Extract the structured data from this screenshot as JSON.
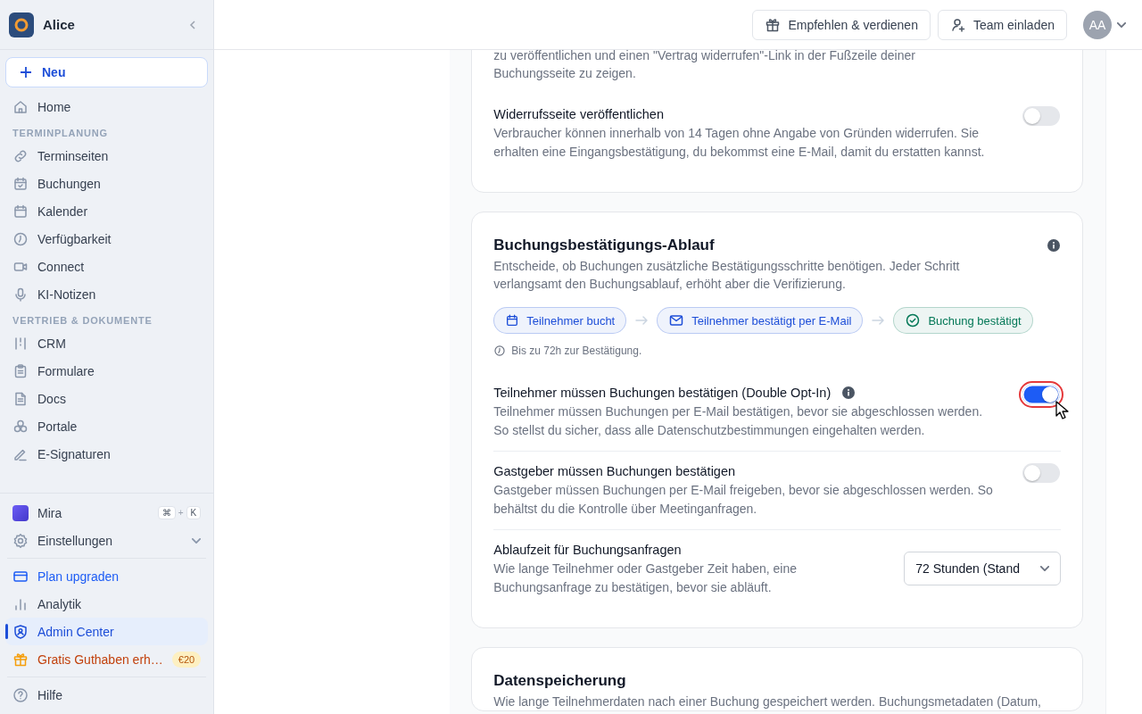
{
  "sidebar": {
    "workspace": "Alice",
    "new_button": "Neu",
    "sections": [
      {
        "items": [
          {
            "label": "Home",
            "selected": false
          }
        ]
      },
      {
        "heading": "TERMINPLANUNG",
        "items": [
          {
            "label": "Terminseiten",
            "selected": false
          },
          {
            "label": "Buchungen",
            "selected": false
          },
          {
            "label": "Kalender",
            "selected": false
          },
          {
            "label": "Verfügbarkeit",
            "selected": false
          },
          {
            "label": "Connect",
            "selected": false
          },
          {
            "label": "KI-Notizen",
            "selected": false
          }
        ]
      },
      {
        "heading": "VERTRIEB & DOKUMENTE",
        "items": [
          {
            "label": "CRM",
            "selected": false
          },
          {
            "label": "Formulare",
            "selected": false
          },
          {
            "label": "Docs",
            "selected": false
          },
          {
            "label": "Portale",
            "selected": false
          },
          {
            "label": "E-Signaturen",
            "selected": false
          }
        ]
      }
    ],
    "assistant": {
      "label": "Mira",
      "shortcut": [
        "⌘",
        "+",
        "K"
      ]
    },
    "settings": {
      "label": "Einstellungen",
      "expanded": false
    },
    "bottom_items": [
      {
        "kind": "upgrade",
        "label": "Plan upgraden",
        "selected": false
      },
      {
        "kind": "plain",
        "label": "Analytik",
        "selected": false
      },
      {
        "kind": "plain",
        "label": "Admin Center",
        "selected": true
      },
      {
        "kind": "promo",
        "label": "Gratis Guthaben erh…",
        "badge": "€20",
        "selected": false
      }
    ],
    "help": "Hilfe"
  },
  "topbar": {
    "buttons": [
      "Empfehlen & verdienen",
      "Team einladen"
    ],
    "avatar": "AA"
  },
  "cards": [
    {
      "intro": "zu veröffentlichen und einen \"Vertrag widerrufen\"-Link in der Fußzeile deiner Buchungsseite zu zeigen.",
      "settings": [
        {
          "kind": "toggle",
          "title": "Widerrufsseite veröffentlichen",
          "description": "Verbraucher können innerhalb von 14 Tagen ohne Angabe von Gründen widerrufen. Sie erhalten eine Eingangsbestätigung, du bekommst eine E-Mail, damit du erstatten kannst.",
          "on": false,
          "focused": false
        }
      ]
    },
    {
      "title": "Buchungsbestätigungs-Ablauf",
      "description": "Entscheide, ob Buchungen zusätzliche Bestätigungsschritte benötigen. Jeder Schritt verlangsamt den Buchungsablauf, erhöht aber die Verifizierung.",
      "flow": {
        "steps": [
          {
            "label": "Teilnehmer bucht",
            "color": "#1d4ed8"
          },
          {
            "label": "Teilnehmer bestätigt per E-Mail",
            "color": "#1d4ed8"
          },
          {
            "label": "Buchung bestätigt",
            "color": "#047857"
          }
        ],
        "note": "Bis zu 72h zur Bestätigung."
      },
      "settings": [
        {
          "kind": "toggle",
          "title": "Teilnehmer müssen Buchungen bestätigen (Double Opt-In)",
          "info": true,
          "description": "Teilnehmer müssen Buchungen per E-Mail bestätigen, bevor sie abgeschlossen werden. So stellst du sicher, dass alle Datenschutzbestimmungen eingehalten werden.",
          "on": true,
          "focused": true
        },
        {
          "kind": "toggle",
          "title": "Gastgeber müssen Buchungen bestätigen",
          "description": "Gastgeber müssen Buchungen per E-Mail freigeben, bevor sie abgeschlossen werden. So behältst du die Kontrolle über Meetinganfragen.",
          "on": false,
          "focused": false
        },
        {
          "kind": "select",
          "title": "Ablaufzeit für Buchungsanfragen",
          "description": "Wie lange Teilnehmer oder Gastgeber Zeit haben, eine Buchungsanfrage zu bestätigen, bevor sie abläuft.",
          "value": "72 Stunden (Stand"
        }
      ]
    },
    {
      "title": "Datenspeicherung",
      "description": "Wie lange Teilnehmerdaten nach einer Buchung gespeichert werden. Buchungsmetadaten (Datum,"
    }
  ]
}
